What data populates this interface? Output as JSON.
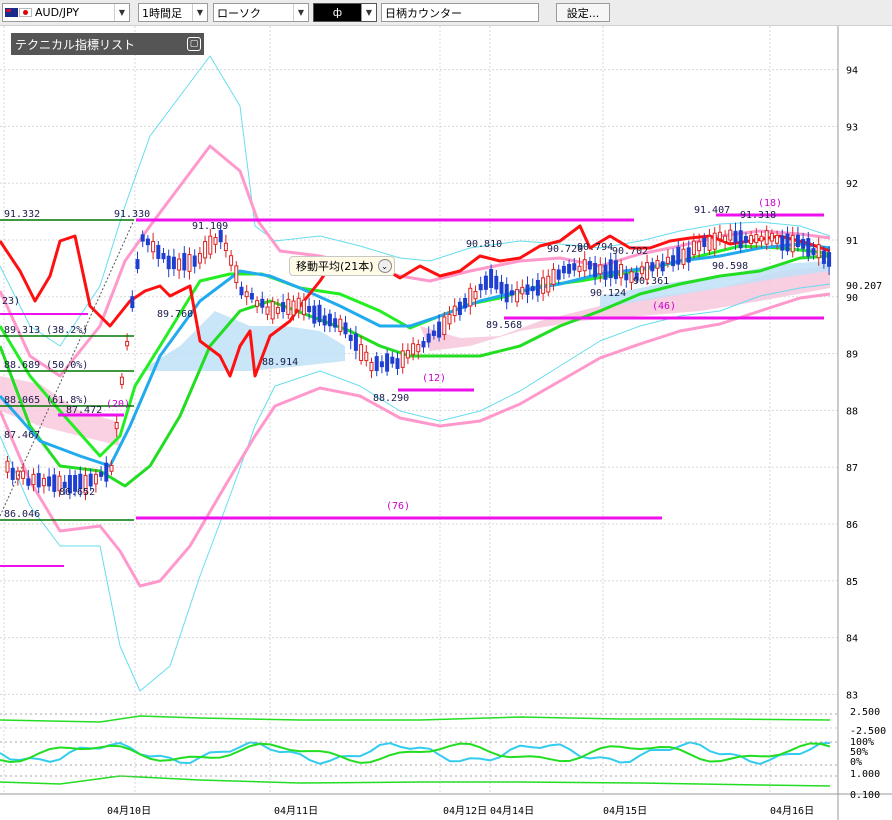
{
  "toolbar": {
    "pair": "AUD/JPY",
    "timeframe": "1時間足",
    "chart_type": "ローソク",
    "symbol_box": "ф",
    "counter": "日柄カウンター",
    "settings": "設定..."
  },
  "indicator_list": {
    "title": "テクニカル指標リスト"
  },
  "ma_tooltip": {
    "label": "移動平均(21本)"
  },
  "axis": {
    "price_ticks": [
      "94",
      "93",
      "92",
      "91",
      "90",
      "89",
      "88",
      "87",
      "86",
      "85",
      "84",
      "83"
    ],
    "current_price": "90.207",
    "sub_ticks": [
      "2.500",
      "-2.500",
      "100%",
      "50%",
      "0%",
      "1.000",
      "0.100"
    ],
    "dates": [
      "04月10日",
      "04月11日",
      "04月12日",
      "04月14日",
      "04月15日",
      "04月16日"
    ]
  },
  "fib_labels": [
    "91.332",
    "89.313 (38.2%)",
    "88.689 (50.0%)",
    "88.065 (61.8%)",
    "86.046",
    "23)"
  ],
  "peak_labels": [
    "91.330",
    "91.109",
    "89.760",
    "88.914",
    "88.290",
    "87.472",
    "86.652",
    "87.467",
    "90.810",
    "89.568",
    "90.720",
    "90.794",
    "90.702",
    "90.124",
    "90.361",
    "91.407",
    "91.318",
    "90.598"
  ],
  "count_labels": [
    "(76)",
    "(12)",
    "(46)",
    "(18)",
    "(20)"
  ],
  "colors": {
    "bull": "#dd2222",
    "bear": "#1f3fd0",
    "ma_fast": "#ff1010",
    "ma_green": "#22dd22",
    "ma_blue": "#22aaee",
    "bb_outer": "#66ddee",
    "bb_inner": "#ff99cc",
    "magenta": "#ee11ee",
    "fib": "#007700"
  }
}
